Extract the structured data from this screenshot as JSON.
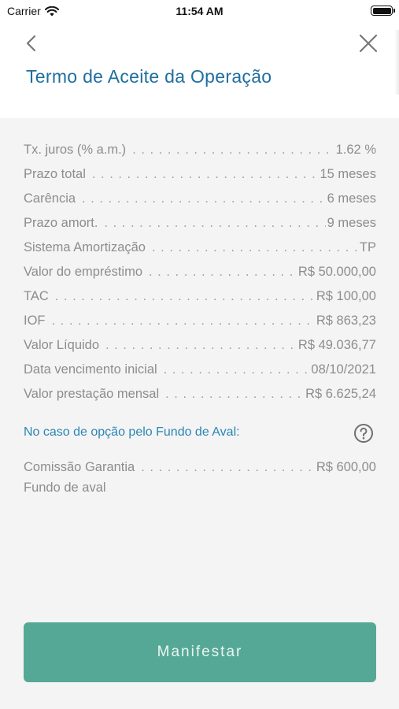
{
  "status_bar": {
    "carrier": "Carrier",
    "time": "11:54 AM",
    "icons": [
      "wifi-icon",
      "battery-icon"
    ]
  },
  "nav": {
    "back_icon": "chevron-left-icon",
    "close_icon": "close-icon",
    "title": "Termo de Aceite da Operação"
  },
  "details": [
    {
      "label": "Tx. juros (% a.m.)",
      "value": "1.62 %"
    },
    {
      "label": "Prazo total",
      "value": "15 meses"
    },
    {
      "label": "Carência",
      "value": "6 meses"
    },
    {
      "label": "Prazo amort.",
      "value": "9 meses"
    },
    {
      "label": "Sistema Amortização",
      "value": "TP"
    },
    {
      "label": "Valor do empréstimo",
      "value": "R$ 50.000,00"
    },
    {
      "label": "TAC",
      "value": "R$ 100,00"
    },
    {
      "label": "IOF",
      "value": "R$ 863,23"
    },
    {
      "label": "Valor Líquido",
      "value": "R$ 49.036,77"
    },
    {
      "label": "Data vencimento inicial",
      "value": "08/10/2021"
    },
    {
      "label": "Valor prestação mensal",
      "value": "R$ 6.625,24"
    }
  ],
  "aval": {
    "note": "No caso de opção pelo Fundo de Aval:",
    "help_icon": "question-circle-icon",
    "guarantee_label": "Comissão Garantia",
    "guarantee_value": "R$ 600,00",
    "guarantee_sub": "Fundo de aval"
  },
  "actions": {
    "submit_label": "Manifestar"
  },
  "colors": {
    "title": "#1f6ea0",
    "note": "#2a86b4",
    "button": "#56a896",
    "text": "#8d8d8d",
    "background": "#f4f4f4"
  }
}
